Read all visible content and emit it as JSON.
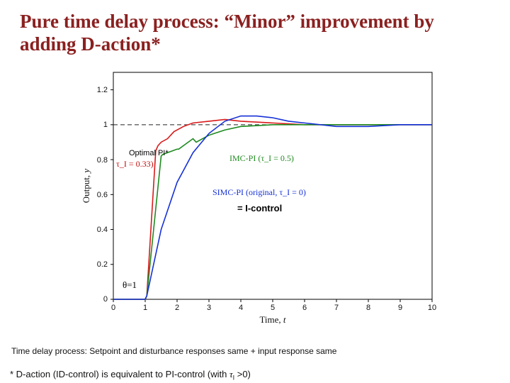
{
  "title": "Pure time delay process: “Minor” improvement by adding D-action*",
  "chart_data": {
    "type": "line",
    "xlabel": "Time, t",
    "ylabel": "Output, y",
    "xlim": [
      0,
      10
    ],
    "ylim": [
      0,
      1.3
    ],
    "xticks": [
      0,
      1,
      2,
      3,
      4,
      5,
      6,
      7,
      8,
      9,
      10
    ],
    "yticks": [
      0,
      0.2,
      0.4,
      0.6,
      0.8,
      1,
      1.2
    ],
    "reference": 1,
    "series": [
      {
        "name": "Optimal PI* (τ_I = 0.33)",
        "color": "#d91a1a",
        "x": [
          0,
          1,
          1.05,
          1.33,
          1.4,
          1.5,
          1.7,
          1.9,
          2.2,
          2.5,
          3.0,
          3.5,
          4.0,
          5.0,
          6.0,
          8.0,
          10.0
        ],
        "y": [
          0,
          0,
          0.02,
          0.85,
          0.88,
          0.9,
          0.92,
          0.96,
          0.99,
          1.01,
          1.02,
          1.03,
          1.02,
          1.01,
          1.0,
          1.0,
          1.0
        ]
      },
      {
        "name": "IMC-PI (τ_I = 0.5)",
        "color": "#1f8a1f",
        "x": [
          0,
          1,
          1.05,
          1.5,
          1.55,
          2.0,
          2.05,
          2.5,
          2.6,
          3.0,
          3.5,
          4.0,
          5.0,
          6.0,
          8.0,
          10.0
        ],
        "y": [
          0,
          0,
          0.02,
          0.82,
          0.83,
          0.86,
          0.86,
          0.92,
          0.9,
          0.94,
          0.97,
          0.99,
          1.0,
          1.0,
          1.0,
          1.0
        ]
      },
      {
        "name": "SIMC-PI (original, τ_I = 0)",
        "color": "#1530d6",
        "x": [
          0,
          1,
          1.05,
          1.5,
          2.0,
          2.5,
          3.0,
          3.5,
          4.0,
          4.5,
          5.0,
          5.5,
          6.0,
          7.0,
          8.0,
          9.0,
          10.0
        ],
        "y": [
          0,
          0,
          0.02,
          0.4,
          0.67,
          0.84,
          0.95,
          1.02,
          1.05,
          1.05,
          1.04,
          1.02,
          1.01,
          0.99,
          0.99,
          1.0,
          1.0
        ]
      }
    ],
    "annotations": {
      "optimal_pi": "Optimal PI*",
      "tau_red": "τ_I = 0.33)",
      "imc_pi": "IMC-PI (τ_I = 0.5)",
      "simc_pi": "SIMC-PI (original, τ_I = 0)",
      "eq_icontrol": "= I-control",
      "theta": "θ=1"
    }
  },
  "footnote1": "Time delay process: Setpoint and disturbance responses same + input response same",
  "footnote2_pre": "* D-action (ID-control) is equivalent to PI-control (with ",
  "footnote2_tau": "τ",
  "footnote2_sub": "I",
  "footnote2_post": " >0)"
}
